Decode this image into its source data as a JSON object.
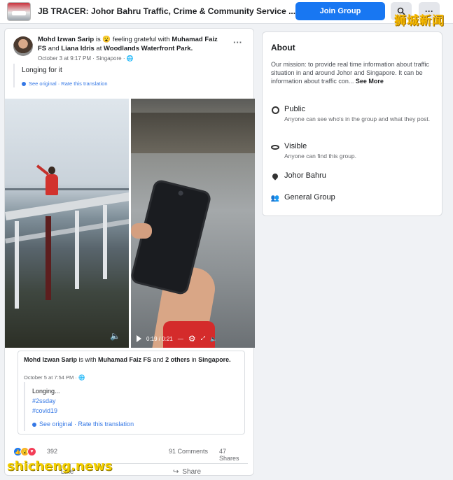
{
  "topbar": {
    "group_title": "JB TRACER: Johor Bahru Traffic, Crime & Community Service ...",
    "join_label": "Join Group",
    "search_icon": "search-icon",
    "more_label": "···"
  },
  "watermarks": {
    "top_right": "狮城新闻",
    "bottom_left": "shicheng.news"
  },
  "post": {
    "author": "Mohd Izwan Sarip",
    "feeling_text": " is 😮 feeling grateful with ",
    "with1": "Muhamad Faiz FS",
    "and_text": " and ",
    "with2": "Liana Idris",
    "at_text": " at ",
    "place": "Woodlands Waterfront Park.",
    "meta": "October 3 at 9:17 PM · Singapore · 🌐",
    "dots": "···",
    "caption": "Longing for it",
    "translation": "See original · Rate this translation",
    "video_time": "0:19 / 0:21",
    "shared": {
      "author": "Mohd Izwan Sarip",
      "with_text": " is with ",
      "with1": "Muhamad Faiz FS",
      "and_text": " and ",
      "others": "2 others",
      "in_text": " in ",
      "place": "Singapore.",
      "meta": "October 5 at 7:54 PM · 🌐",
      "line1": "Longing...",
      "tag1": "#2ssday",
      "tag2": "#covid19",
      "translation": "See original · Rate this translation"
    },
    "reaction_count": "392",
    "comments": "91 Comments",
    "shares": "47 Shares",
    "like_label": "Like",
    "share_label": "Share"
  },
  "about": {
    "title": "About",
    "desc": "Our mission: to provide real time information about traffic situation in and around Johor and Singapore. It can be information about traffic con...",
    "see_more": "See More",
    "items": [
      {
        "icon": "globe-icon",
        "title": "Public",
        "sub": "Anyone can see who's in the group and what they post."
      },
      {
        "icon": "eye-icon",
        "title": "Visible",
        "sub": "Anyone can find this group."
      },
      {
        "icon": "location-pin-icon",
        "title": "Johor Bahru",
        "sub": ""
      },
      {
        "icon": "group-icon",
        "title": "General Group",
        "sub": ""
      }
    ]
  }
}
